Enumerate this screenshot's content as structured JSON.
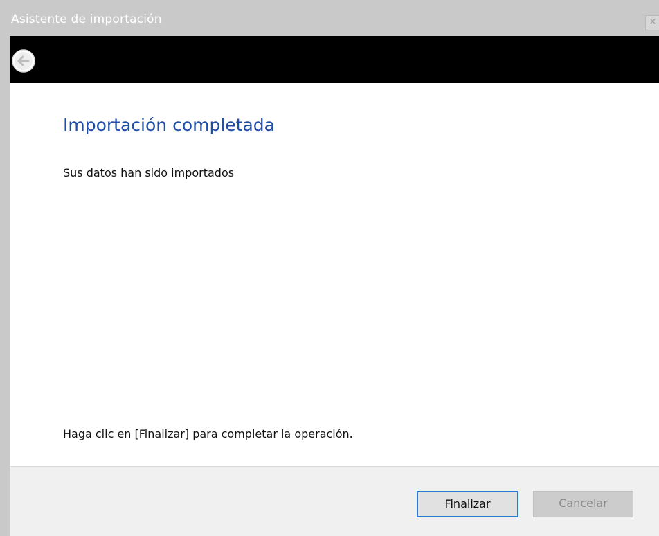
{
  "window": {
    "title": "Asistente de importación",
    "close_glyph": "×"
  },
  "header": {
    "back_icon": "back-arrow-icon"
  },
  "content": {
    "title": "Importación completada",
    "description": "Sus datos han sido importados",
    "instruction": "Haga clic en  [Finalizar] para completar la operación."
  },
  "footer": {
    "finish_label": "Finalizar",
    "cancel_label": "Cancelar"
  },
  "colors": {
    "title_blue": "#1f4ea8",
    "header_bar": "#000000",
    "focus_border": "#2b7bd4"
  }
}
